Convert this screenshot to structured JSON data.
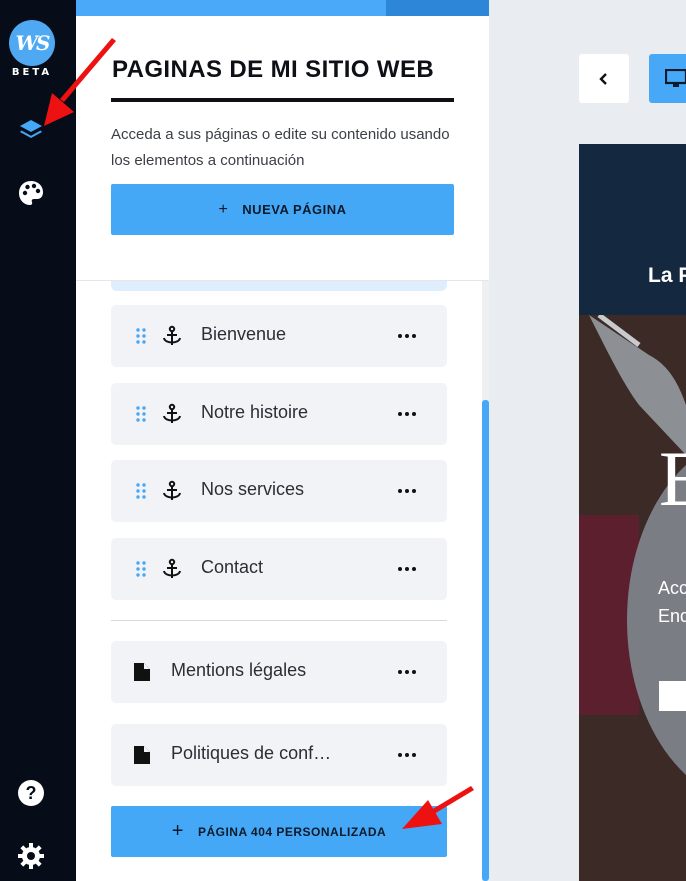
{
  "rail": {
    "logo_text": "WS",
    "beta_label": "BETA",
    "icons": [
      "layers-icon",
      "palette-icon",
      "help-icon",
      "settings-icon"
    ]
  },
  "panel": {
    "title": "PAGINAS DE MI SITIO WEB",
    "description": "Acceda a sus páginas o edite su contenido usando los elementos a continuación",
    "new_page_button": "NUEVA PÁGINA",
    "anchor_pages": [
      {
        "label": "Bienvenue"
      },
      {
        "label": "Notre histoire"
      },
      {
        "label": "Nos services"
      },
      {
        "label": "Contact"
      }
    ],
    "static_pages": [
      {
        "label": "Mentions légales"
      },
      {
        "label": "Politiques de conf…"
      }
    ],
    "custom_404_button": "PÁGINA 404 PERSONALIZADA"
  },
  "preview": {
    "site_title": "La P",
    "hero_letter": "E",
    "hero_line1": "Acc",
    "hero_line2": "End"
  },
  "colors": {
    "accent": "#46a8f6",
    "rail_bg": "#060d18",
    "annotation_arrow": "#ee1111"
  }
}
